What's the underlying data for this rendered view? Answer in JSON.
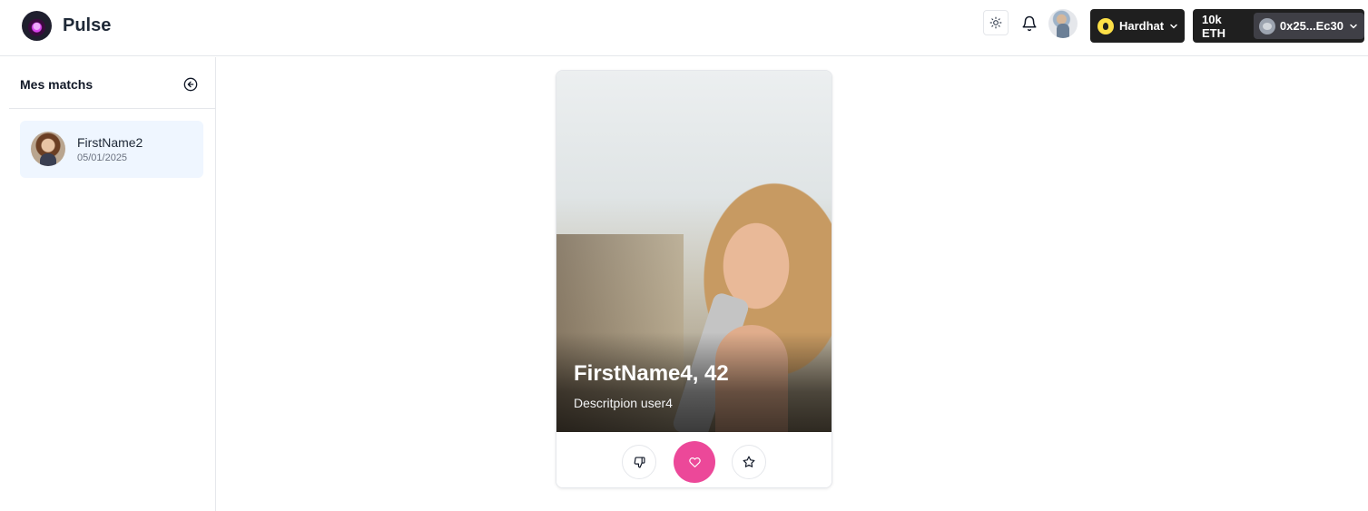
{
  "header": {
    "app_name": "Pulse",
    "logo_icon": "pulse-logo-icon",
    "theme_icon": "sun-icon",
    "notification_icon": "bell-icon",
    "network": {
      "label": "Hardhat",
      "icon": "hardhat-network-icon"
    },
    "account": {
      "balance": "10k ETH",
      "address": "0x25...Ec30",
      "icon": "account-avatar-icon"
    }
  },
  "sidebar": {
    "title": "Mes matchs",
    "collapse_icon": "arrow-left-circle-icon",
    "matches": [
      {
        "name": "FirstName2",
        "date": "05/01/2025"
      }
    ]
  },
  "profile": {
    "name_age": "FirstName4, 42",
    "description": "Descritpion user4",
    "actions": {
      "dislike_icon": "thumbs-down-icon",
      "like_icon": "heart-icon",
      "favorite_icon": "star-icon"
    }
  },
  "colors": {
    "accent": "#ec4899",
    "header_button_bg": "#1f1f1f",
    "selected_match_bg": "#eff6ff"
  }
}
